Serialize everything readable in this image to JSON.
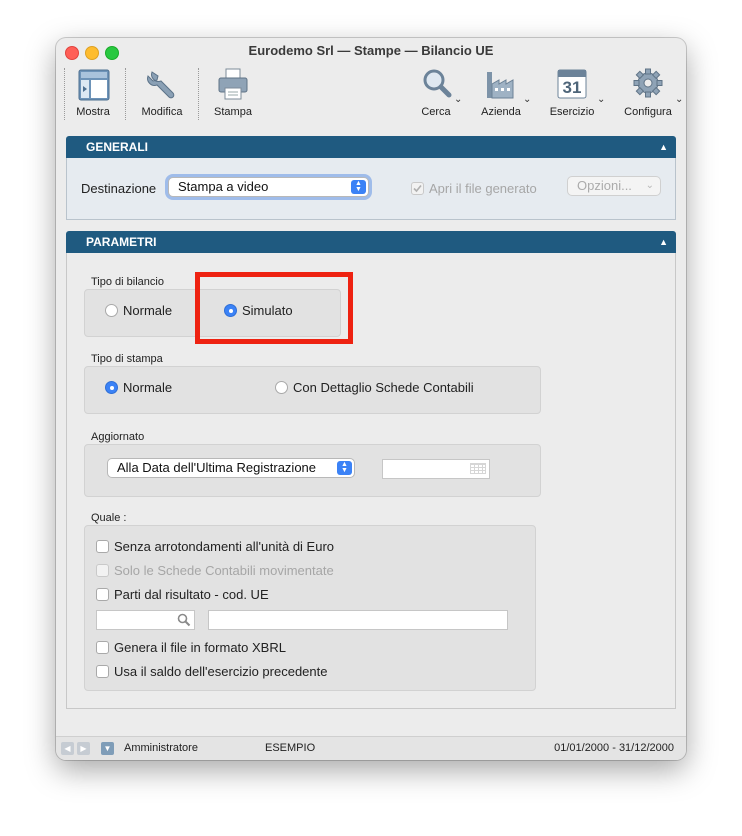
{
  "window": {
    "title": "Eurodemo Srl — Stampe — Bilancio UE"
  },
  "toolbar": {
    "left": [
      {
        "label": "Mostra",
        "icon": "layout-icon"
      },
      {
        "label": "Modifica",
        "icon": "wrench-icon"
      },
      {
        "label": "Stampa",
        "icon": "printer-icon"
      }
    ],
    "right": [
      {
        "label": "Cerca",
        "icon": "magnifier-icon"
      },
      {
        "label": "Azienda",
        "icon": "factory-icon"
      },
      {
        "label": "Esercizio",
        "icon": "calendar-icon",
        "calendar_day": "31"
      },
      {
        "label": "Configura",
        "icon": "gear-icon"
      }
    ]
  },
  "generali": {
    "title": "GENERALI",
    "destinazione_label": "Destinazione",
    "destinazione_value": "Stampa a video",
    "apri_file_label": "Apri il file generato",
    "apri_file_checked": true,
    "opzioni_label": "Opzioni..."
  },
  "parametri": {
    "title": "PARAMETRI",
    "tipo_bilancio": {
      "label": "Tipo di bilancio",
      "options": [
        "Normale",
        "Simulato"
      ],
      "selected": "Simulato"
    },
    "tipo_stampa": {
      "label": "Tipo di stampa",
      "options": [
        "Normale",
        "Con Dettaglio Schede Contabili"
      ],
      "selected": "Normale"
    },
    "aggiornato": {
      "label": "Aggiornato",
      "value": "Alla Data dell'Ultima Registrazione",
      "date_value": ""
    },
    "quale": {
      "label": "Quale :",
      "checks": [
        {
          "label": "Senza arrotondamenti all'unità di Euro",
          "checked": false,
          "enabled": true
        },
        {
          "label": "Solo le Schede Contabili movimentate",
          "checked": false,
          "enabled": false
        },
        {
          "label": "Parti dal risultato - cod. UE",
          "checked": false,
          "enabled": true
        },
        {
          "label": "Genera il file in formato XBRL",
          "checked": false,
          "enabled": true
        },
        {
          "label": "Usa il saldo dell'esercizio precedente",
          "checked": false,
          "enabled": true
        }
      ],
      "code_value": "",
      "description_value": ""
    }
  },
  "statusbar": {
    "user": "Amministratore",
    "company": "ESEMPIO",
    "period": "01/01/2000 - 31/12/2000"
  },
  "colors": {
    "panel_header": "#1f5a80",
    "accent_blue": "#3b82f6",
    "highlight_red": "#ee2211"
  }
}
